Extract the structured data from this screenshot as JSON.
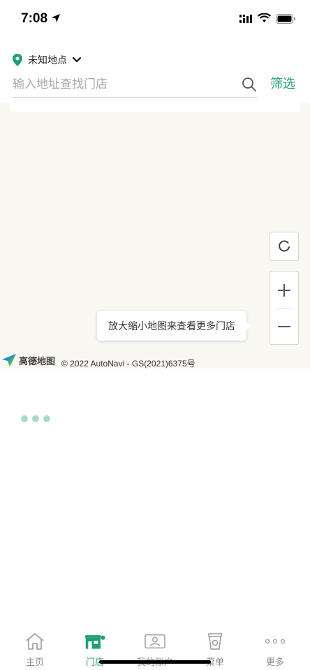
{
  "status_bar": {
    "time": "7:08",
    "icons": [
      "location-arrow-icon",
      "cellular-signal-icon",
      "wifi-icon",
      "battery-icon"
    ]
  },
  "header": {
    "location_label": "未知地点",
    "search_placeholder": "输入地址查找门店",
    "filter_label": "筛选"
  },
  "map": {
    "tooltip": "放大缩小地图来查看更多门店",
    "logo_text": "高德地图",
    "copyright": "© 2022 AutoNavi - GS(2021)6375号",
    "controls": [
      "refresh-icon",
      "zoom-in-icon",
      "zoom-out-icon"
    ]
  },
  "tabs": [
    {
      "label": "主页",
      "icon": "home-icon",
      "active": false
    },
    {
      "label": "门店",
      "icon": "store-icon",
      "active": true
    },
    {
      "label": "我的账户",
      "icon": "account-icon",
      "active": false
    },
    {
      "label": "菜单",
      "icon": "cup-icon",
      "active": false
    },
    {
      "label": "更多",
      "icon": "more-dots-icon",
      "active": false
    }
  ],
  "colors": {
    "accent": "#1f9f73",
    "map_background": "#f8f7f1",
    "loading_dot": "#a8dcc6",
    "tab_inactive": "#8a8a8a"
  }
}
